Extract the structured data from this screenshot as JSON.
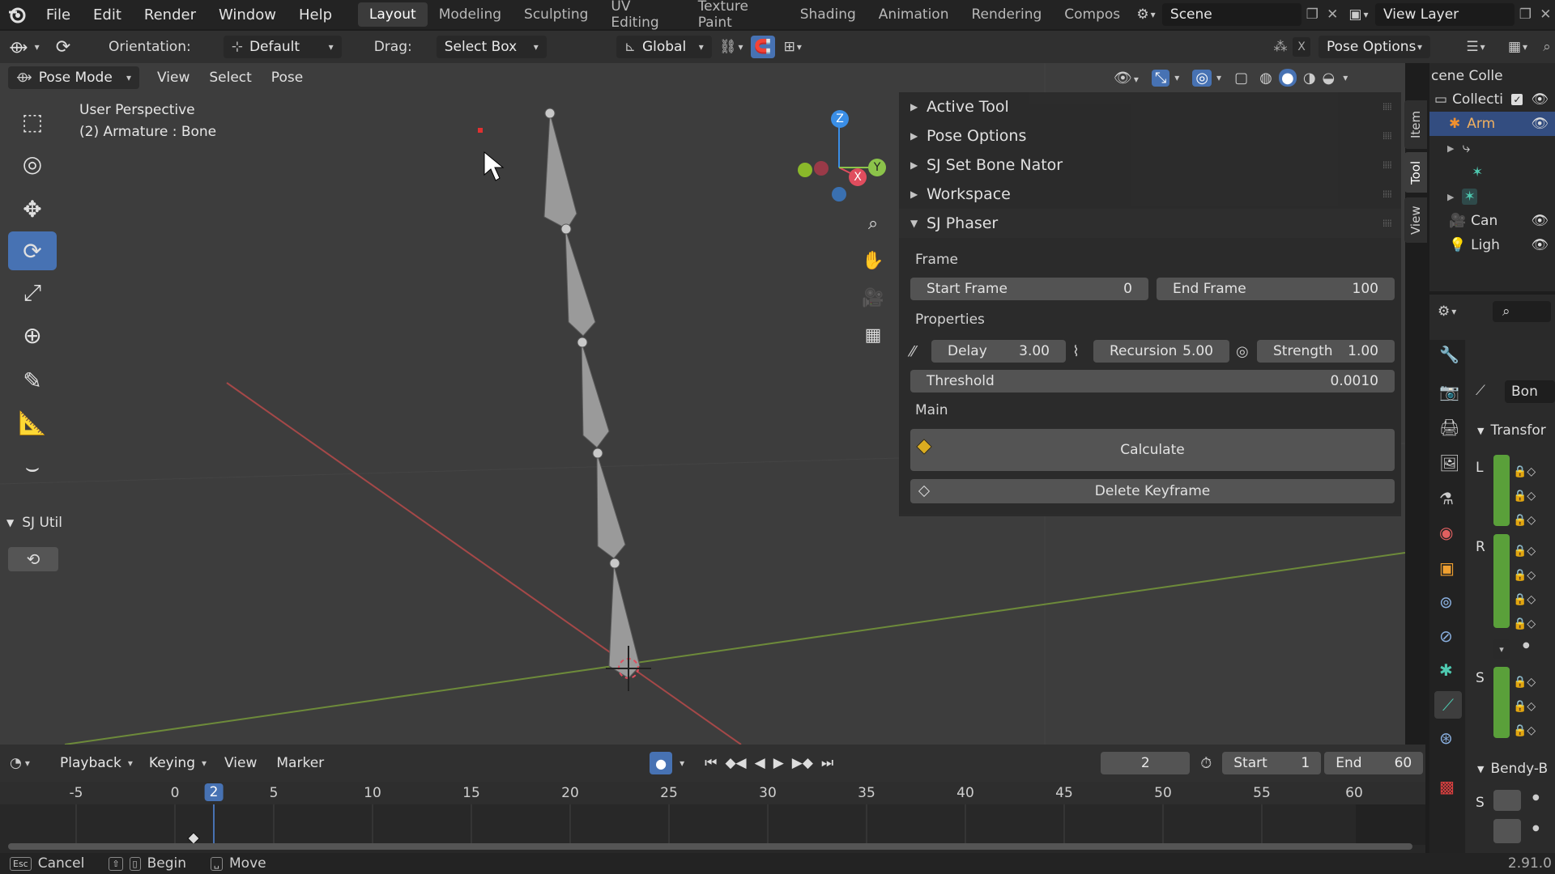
{
  "menubar": {
    "items": [
      "File",
      "Edit",
      "Render",
      "Window",
      "Help"
    ],
    "workspaces": [
      "Layout",
      "Modeling",
      "Sculpting",
      "UV Editing",
      "Texture Paint",
      "Shading",
      "Animation",
      "Rendering",
      "Compos"
    ],
    "active_workspace": "Layout",
    "scene": "Scene",
    "view_layer": "View Layer"
  },
  "toolbar": {
    "orientation_label": "Orientation:",
    "orientation_value": "Default",
    "drag_label": "Drag:",
    "drag_value": "Select Box",
    "transform_orientation": "Global",
    "pose_options": "Pose Options"
  },
  "viewport": {
    "mode": "Pose Mode",
    "menus": [
      "View",
      "Select",
      "Pose"
    ],
    "perspective": "User Perspective",
    "object_info": "(2) Armature : Bone",
    "gizmo_axes": {
      "x": "X",
      "y": "Y",
      "z": "Z"
    }
  },
  "left_panel": {
    "section": "SJ Util"
  },
  "npanel": {
    "tabs": [
      "Item",
      "Tool",
      "View"
    ],
    "active_tab": "Tool",
    "sections": [
      "Active Tool",
      "Pose Options",
      "SJ Set Bone Nator",
      "Workspace"
    ],
    "open_section": "SJ Phaser",
    "frame_label": "Frame",
    "start_frame_label": "Start Frame",
    "start_frame_value": "0",
    "end_frame_label": "End Frame",
    "end_frame_value": "100",
    "properties_label": "Properties",
    "delay_label": "Delay",
    "delay_value": "3.00",
    "recursion_label": "Recursion",
    "recursion_value": "5.00",
    "strength_label": "Strength",
    "strength_value": "1.00",
    "threshold_label": "Threshold",
    "threshold_value": "0.0010",
    "main_label": "Main",
    "calculate_label": "Calculate",
    "delete_label": "Delete Keyframe"
  },
  "outliner": {
    "header": "cene Colle",
    "rows": [
      {
        "label": "Collecti"
      },
      {
        "label": "Arm"
      },
      {
        "label": ""
      },
      {
        "label": ""
      },
      {
        "label": ""
      },
      {
        "label": "Can"
      },
      {
        "label": "Ligh"
      }
    ]
  },
  "properties": {
    "bone_field": "Bon",
    "transform_label": "Transfor",
    "rows": [
      "L",
      "R",
      "S"
    ],
    "bendy_label": "Bendy-B",
    "bendy_row": "S"
  },
  "timeline": {
    "menus": [
      "Playback",
      "Keying",
      "View",
      "Marker"
    ],
    "current_frame": "2",
    "start_label": "Start",
    "start_value": "1",
    "end_label": "End",
    "end_value": "60",
    "ticks": [
      "-5",
      "0",
      "2",
      "5",
      "10",
      "15",
      "20",
      "25",
      "30",
      "35",
      "40",
      "45",
      "50",
      "55",
      "60"
    ]
  },
  "statusbar": {
    "items": [
      "Cancel",
      "Begin",
      "Move"
    ],
    "version": "2.91.0"
  },
  "colors": {
    "accent": "#4772b3",
    "axis_x": "#e04d5e",
    "axis_y": "#8bc34a",
    "axis_z": "#3a8ee6",
    "green_keyed": "#5aa03a"
  }
}
